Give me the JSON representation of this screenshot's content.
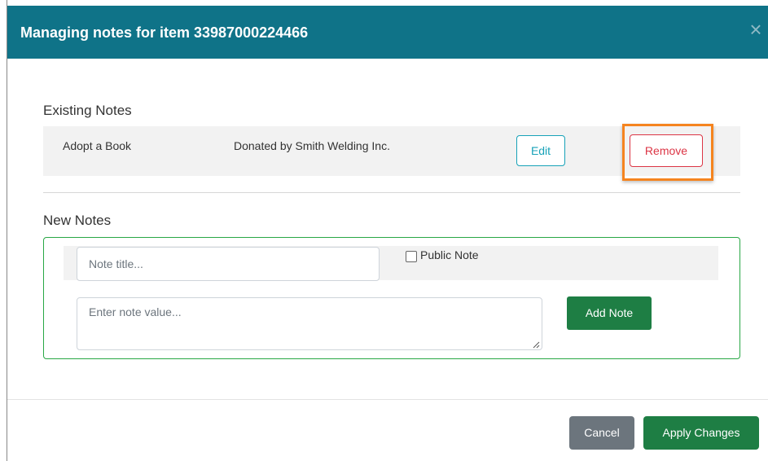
{
  "modal": {
    "title": "Managing notes for item 33987000224466",
    "close_icon": "×"
  },
  "existing_notes": {
    "heading": "Existing Notes",
    "items": [
      {
        "title": "Adopt a Book",
        "value": "Donated by Smith Welding Inc.",
        "edit_label": "Edit",
        "remove_label": "Remove"
      }
    ]
  },
  "new_notes": {
    "heading": "New Notes",
    "title_placeholder": "Note title...",
    "public_label": "Public Note",
    "public_checked": false,
    "value_placeholder": "Enter note value...",
    "add_label": "Add Note"
  },
  "footer": {
    "cancel_label": "Cancel",
    "apply_label": "Apply Changes"
  },
  "colors": {
    "header_bg": "#0f7388",
    "edit": "#17a2b8",
    "remove": "#dc3545",
    "highlight": "#f5841f",
    "primary_green": "#1e7e44",
    "new_box_border": "#28a745",
    "cancel": "#6c757d"
  }
}
